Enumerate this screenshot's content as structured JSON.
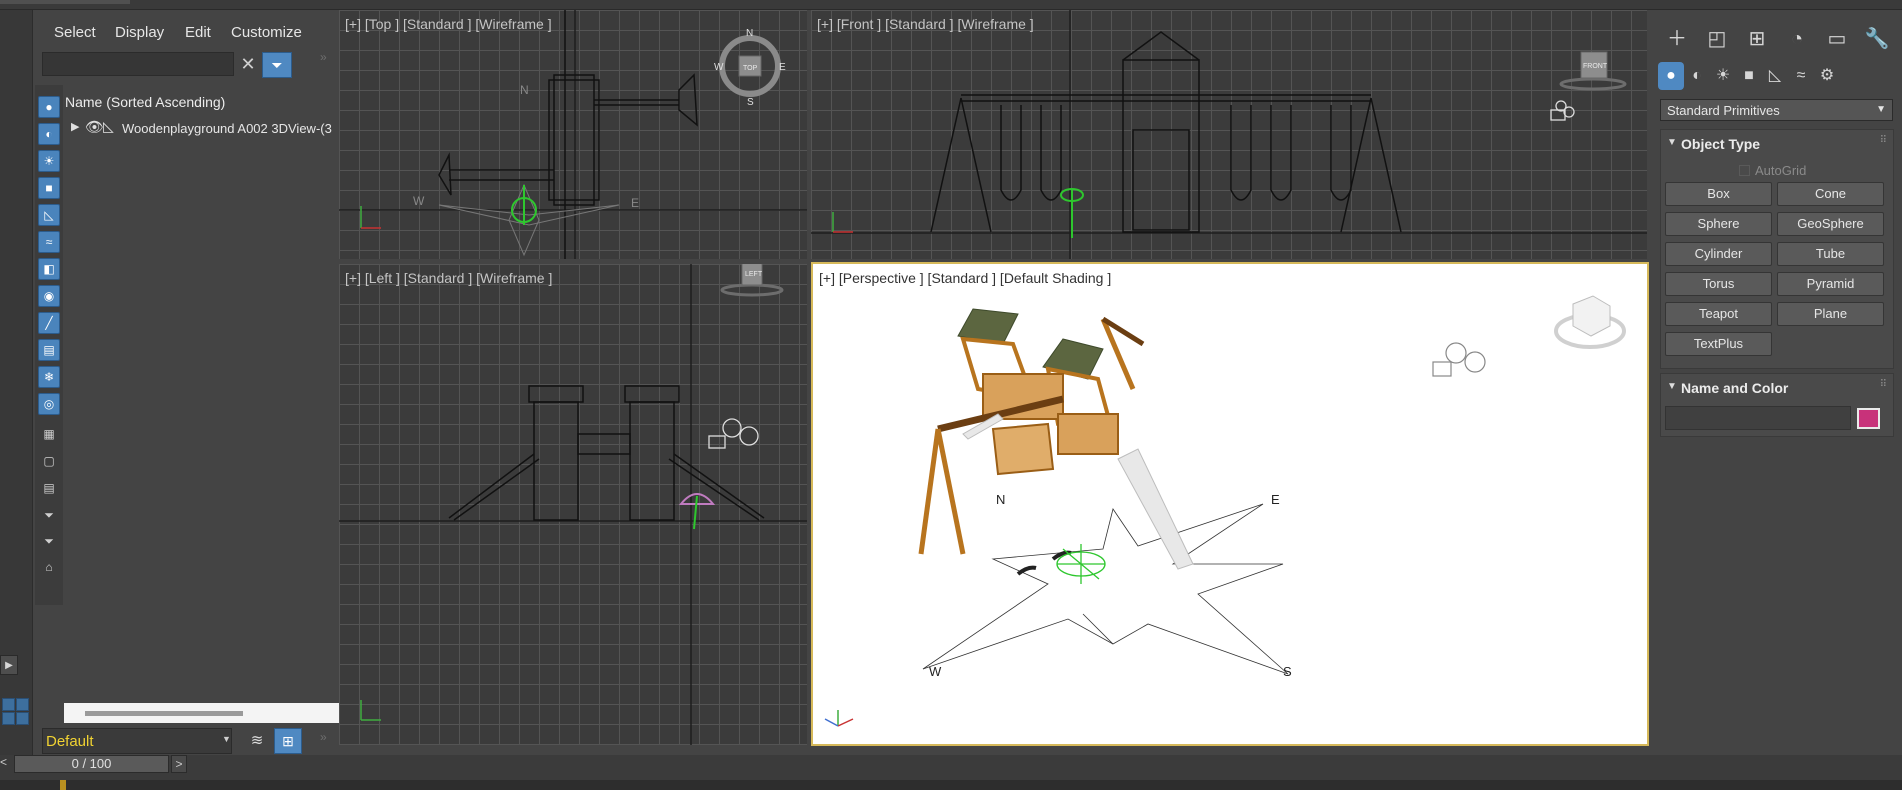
{
  "scene_explorer": {
    "menu": [
      "Select",
      "Display",
      "Edit",
      "Customize"
    ],
    "column_header": "Name (Sorted Ascending)",
    "items": [
      {
        "label": "Woodenplayground A002 3DView-(3"
      }
    ],
    "layer_name": "Default"
  },
  "viewports": {
    "top": {
      "label": "[+] [Top ] [Standard ] [Wireframe ]",
      "compass": [
        "N",
        "S",
        "E",
        "W"
      ],
      "cube_label": "TOP"
    },
    "front": {
      "label": "[+] [Front ] [Standard ] [Wireframe ]",
      "cube_label": "FRONT"
    },
    "left": {
      "label": "[+] [Left ] [Standard ] [Wireframe ]",
      "cube_label": "LEFT"
    },
    "perspective": {
      "label": "[+] [Perspective ] [Standard ] [Default Shading ]",
      "compass": [
        "N",
        "E",
        "W",
        "S"
      ]
    }
  },
  "command_panel": {
    "category": "Standard Primitives",
    "object_type": {
      "title": "Object Type",
      "autogrid": "AutoGrid",
      "buttons": [
        "Box",
        "Cone",
        "Sphere",
        "GeoSphere",
        "Cylinder",
        "Tube",
        "Torus",
        "Pyramid",
        "Teapot",
        "Plane",
        "TextPlus"
      ]
    },
    "name_and_color": {
      "title": "Name and Color",
      "object_name": "",
      "color": "#c8327a"
    }
  },
  "timeline": {
    "frame": "0 / 100"
  },
  "colors": {
    "accent": "#4f89c2",
    "active_viewport_border": "#d6b95a",
    "layer_text": "#f0d232",
    "wood": "#b8741e",
    "roof": "#5c6640"
  }
}
